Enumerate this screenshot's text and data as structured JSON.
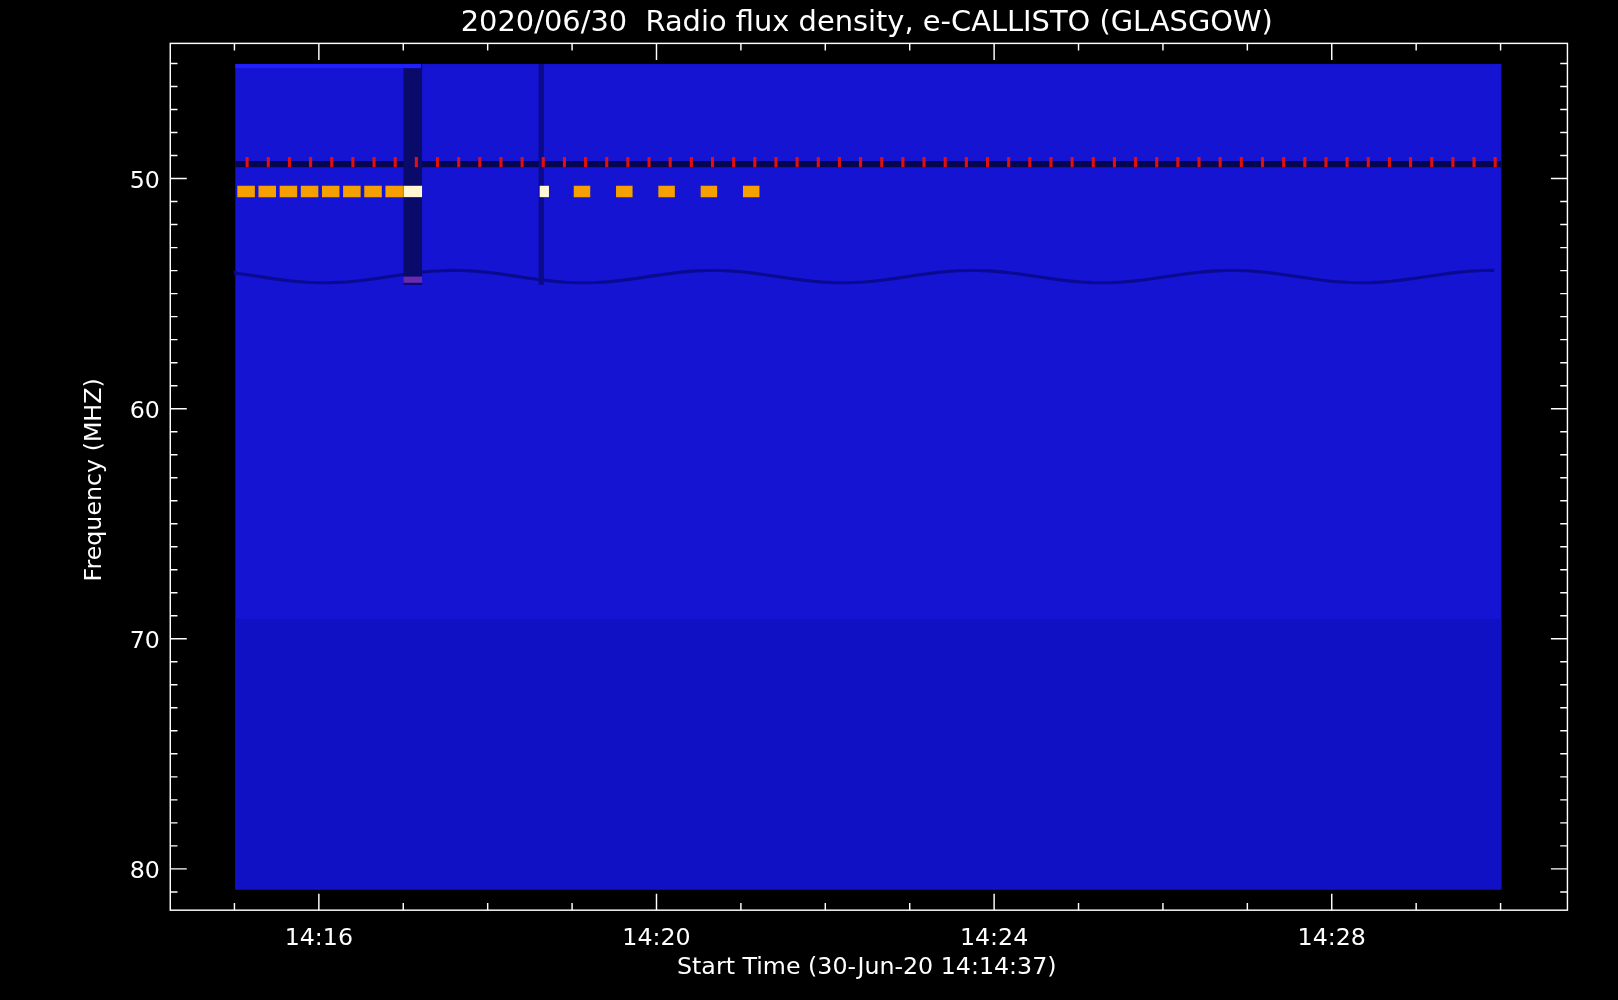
{
  "title": "2020/06/30  Radio flux density, e-CALLISTO (GLASGOW)",
  "y_axis": {
    "label": "Frequency (MHZ)",
    "ticks": [
      "50",
      "60",
      "70",
      "80"
    ]
  },
  "x_axis": {
    "label": "Start Time (30-Jun-20 14:14:37)",
    "ticks": [
      "14:16",
      "14:20",
      "14:24",
      "14:28"
    ]
  }
}
